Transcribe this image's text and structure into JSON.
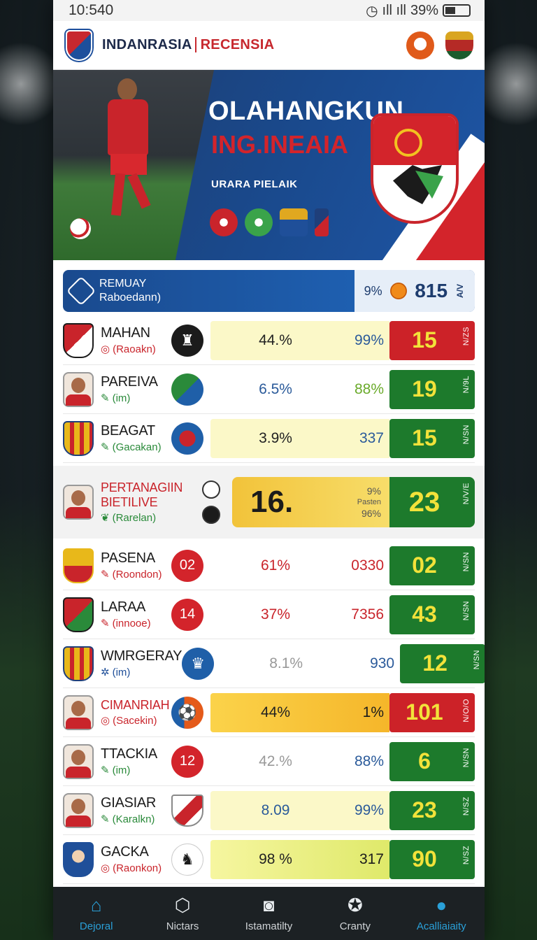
{
  "status": {
    "time": "10:540",
    "battery_pct": "39%",
    "signal_text": "ıll ıll"
  },
  "header": {
    "title": "INDANRASIA",
    "title_accent": "RECENSIA",
    "badge_left_icon": "flag-crest-icon",
    "badge_right_icon": "club-crest-icon"
  },
  "hero": {
    "title": "OLAHANGKUN",
    "subtitle": "ING.INEAIA",
    "tagline": "URARA PIELAIK",
    "icons": [
      "club-badge-red-icon",
      "club-badge-green-icon",
      "club-badge-blue-icon",
      "club-badge-flag-icon"
    ]
  },
  "summary": {
    "label": "REMUAY",
    "sub": "Raboedann)",
    "pct": "9%",
    "value": "815",
    "vertical": "A/V"
  },
  "rows": [
    {
      "name": "MAHAN",
      "sub": "(Raoakn)",
      "sub_icon": "◎",
      "pct": "44.%",
      "second": "99%",
      "score": "15",
      "vert": "N/ZS",
      "score_color": "red",
      "highlight": "hl"
    },
    {
      "name": "PAREIVA",
      "sub": "(im)",
      "sub_icon": "✎",
      "pct": "6.5%",
      "second": "88%",
      "score": "19",
      "vert": "N/9L",
      "score_color": "green",
      "highlight": ""
    },
    {
      "name": "BEAGAT",
      "sub": "(Gacakan)",
      "sub_icon": "✎",
      "pct": "3.9%",
      "second": "337",
      "score": "15",
      "vert": "N/SN",
      "score_color": "green",
      "highlight": "hl"
    },
    {
      "name": "PASENA",
      "sub": "(Roondon)",
      "sub_icon": "✎",
      "pct": "61%",
      "second": "0330",
      "score": "02",
      "vert": "N/SN",
      "score_color": "green",
      "highlight": ""
    },
    {
      "name": "LARAA",
      "sub": "(innooe)",
      "sub_icon": "✎",
      "pct": "37%",
      "second": "7356",
      "score": "43",
      "vert": "N/SN",
      "score_color": "green",
      "highlight": ""
    },
    {
      "name": "WMRGERAY",
      "sub": "(im)",
      "sub_icon": "✲",
      "pct": "8.1%",
      "second": "930",
      "score": "12",
      "vert": "N/SN",
      "score_color": "green",
      "highlight": ""
    },
    {
      "name": "CIMANRIAH",
      "sub": "(Sacekin)",
      "sub_icon": "◎",
      "pct": "44%",
      "second": "1%",
      "score": "101",
      "vert": "N/O/O",
      "score_color": "red",
      "highlight": "hl2"
    },
    {
      "name": "TTACKIA",
      "sub": "(im)",
      "sub_icon": "✎",
      "pct": "42.%",
      "second": "88%",
      "score": "6",
      "vert": "N/SN",
      "score_color": "green",
      "highlight": ""
    },
    {
      "name": "GIASIAR",
      "sub": "(Karalkn)",
      "sub_icon": "✎",
      "pct": "8.09",
      "second": "99%",
      "score": "23",
      "vert": "N/SZ",
      "score_color": "green",
      "highlight": "hl"
    },
    {
      "name": "GACKA",
      "sub": "(Raonkon)",
      "sub_icon": "◎",
      "pct": "98 %",
      "second": "317",
      "score": "90",
      "vert": "N/SZ",
      "score_color": "green",
      "highlight": "hl3"
    }
  ],
  "featured": {
    "name_line1": "PERTANAGIIN",
    "name_line2": "BIETILIVE",
    "sub": "(Rarelan)",
    "sub_icon": "❦",
    "big": "16.",
    "mini1": "9%",
    "mini2": "Pasten",
    "mini3": "96%",
    "score": "23",
    "vert": "N/V/E"
  },
  "nav": [
    {
      "label": "Dejoral",
      "icon": "⌂",
      "icon_name": "home-icon"
    },
    {
      "label": "Nictars",
      "icon": "⬡",
      "icon_name": "box-icon"
    },
    {
      "label": "Istamatilty",
      "icon": "◙",
      "icon_name": "camera-icon"
    },
    {
      "label": "Cranty",
      "icon": "✪",
      "icon_name": "star-icon"
    },
    {
      "label": "Acalliaiaity",
      "icon": "●",
      "icon_name": "profile-icon"
    }
  ]
}
